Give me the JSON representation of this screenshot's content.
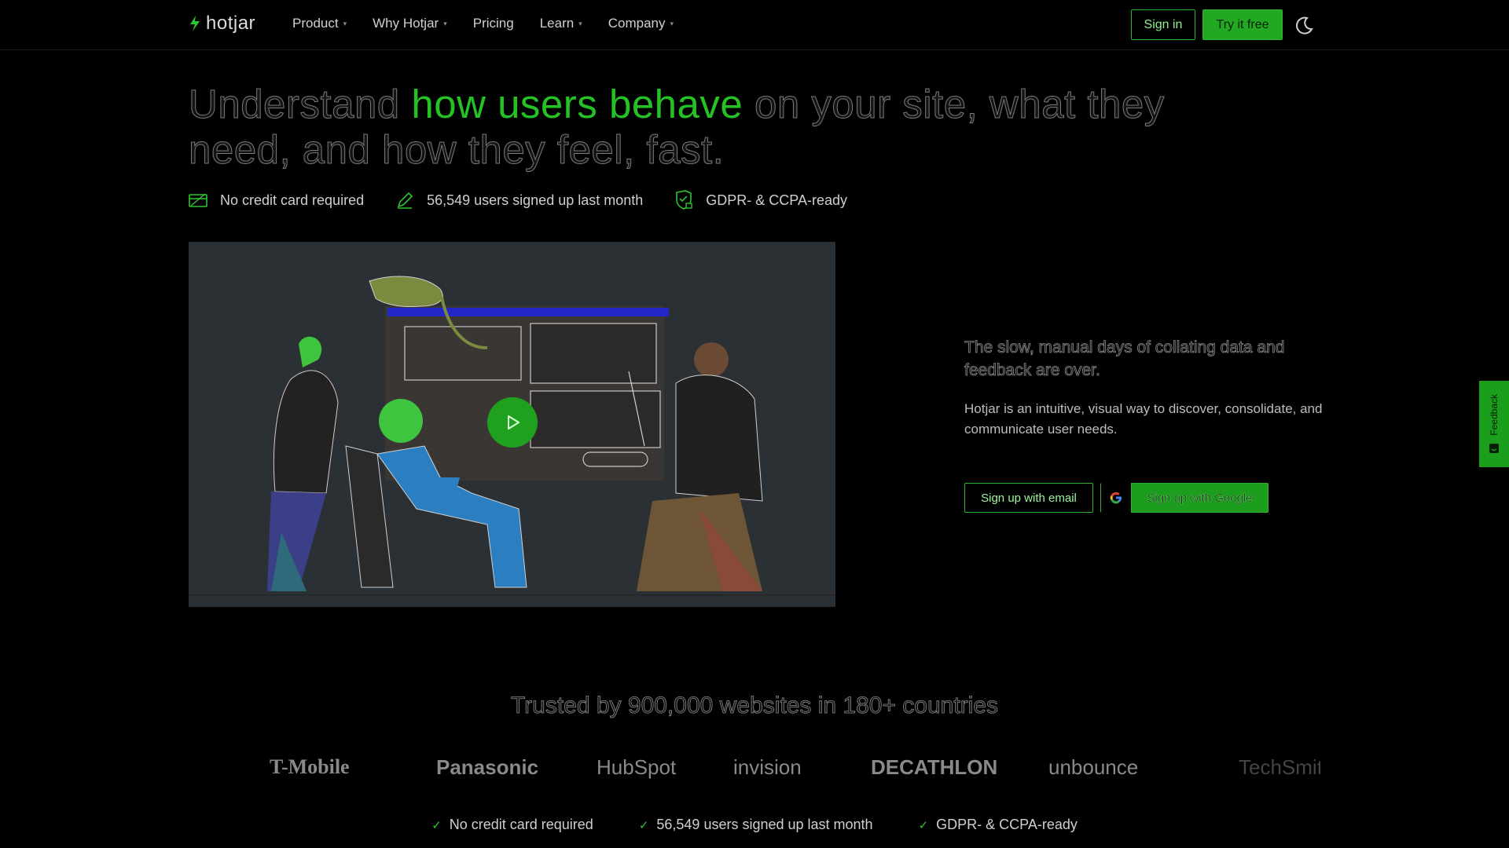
{
  "nav": {
    "brand": "hotjar",
    "links": [
      "Product",
      "Why Hotjar",
      "Pricing",
      "Learn",
      "Company"
    ],
    "signin": "Sign in",
    "try_free": "Try it free"
  },
  "hero": {
    "headline_pre": "Understand ",
    "headline_highlight": "how users behave",
    "headline_post": " on your site, what they need, and how they feel, fast.",
    "badges": [
      "No credit card required",
      "56,549 users signed up last month",
      "GDPR- & CCPA-ready"
    ]
  },
  "aside": {
    "title": "The slow, manual days of collating data and feedback are over.",
    "body": "Hotjar is an intuitive, visual way to discover, consolidate, and communicate user needs.",
    "email_button": "Sign up with email",
    "google_button": "Sign up with Google"
  },
  "feedback_tab": "Feedback",
  "trusted": {
    "heading": "Trusted by 900,000 websites in 180+ countries",
    "logos": [
      "T-Mobile",
      "Panasonic",
      "HubSpot",
      "invision",
      "DECATHLON",
      "unbounce",
      "TechSmith"
    ]
  },
  "footer_checks": [
    "No credit card required",
    "56,549 users signed up last month",
    "GDPR- & CCPA-ready"
  ],
  "colors": {
    "accent": "#25c225",
    "background": "#000000",
    "video_bg": "#2b3035"
  }
}
